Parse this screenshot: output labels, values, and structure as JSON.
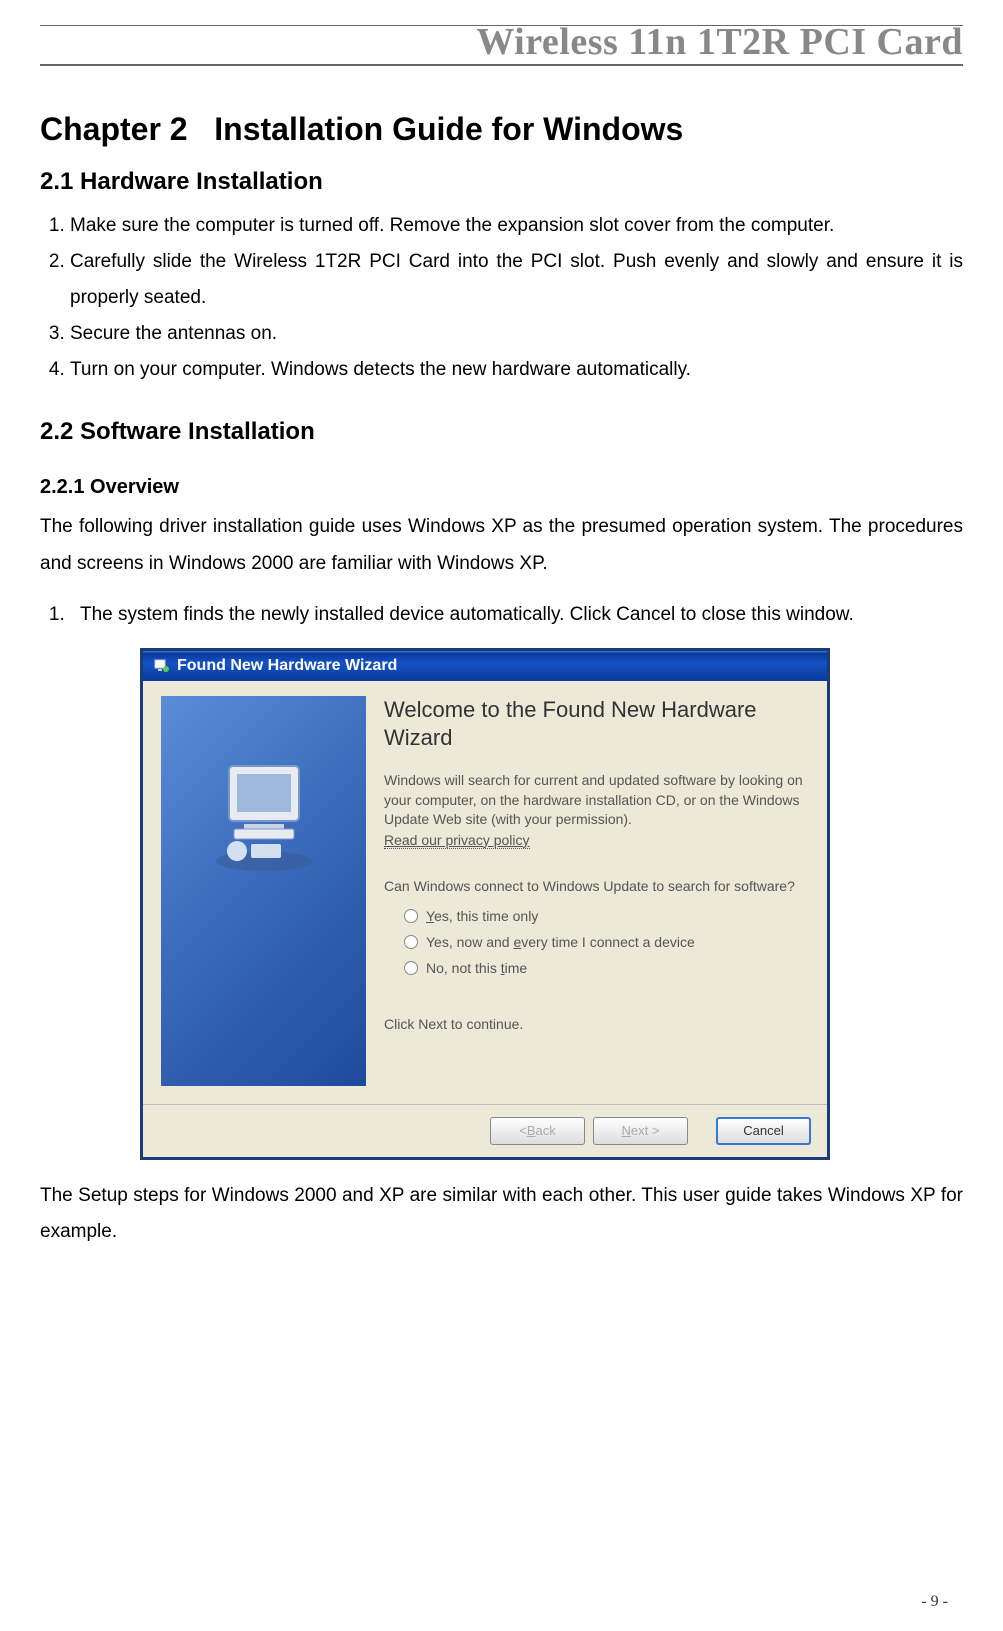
{
  "header": {
    "title": "Wireless 11n 1T2R PCI Card"
  },
  "chapter": {
    "number": "Chapter 2",
    "title": "Installation Guide for Windows"
  },
  "section_hw": {
    "title": "2.1 Hardware Installation",
    "items": [
      "Make sure the computer is turned off. Remove the expansion slot cover from the computer.",
      "Carefully slide the Wireless 1T2R PCI Card into the PCI slot. Push evenly and slowly and ensure it is properly seated.",
      "Secure the antennas on.",
      "Turn on your computer. Windows detects the new hardware automatically."
    ]
  },
  "section_sw": {
    "title": "2.2 Software Installation",
    "overview_title": "2.2.1 Overview",
    "overview_text": "The following driver installation guide uses Windows XP as the presumed operation system. The procedures and screens in Windows 2000 are familiar with Windows XP.",
    "step1_lead": "The system finds the newly installed device automatically. Click ",
    "step1_bold": "Cancel",
    "step1_tail": " to close this window."
  },
  "dialog": {
    "titlebar": "Found New Hardware Wizard",
    "heading": "Welcome to the Found New Hardware Wizard",
    "para": "Windows will search for current and updated software by looking on your computer, on the hardware installation CD, or on the Windows Update Web site (with your permission).",
    "privacy": "Read our privacy policy",
    "question": "Can Windows connect to Windows Update to search for software?",
    "radios": {
      "r1_pre": "",
      "r1_u": "Y",
      "r1_post": "es, this time only",
      "r2_pre": "Yes, now and ",
      "r2_u": "e",
      "r2_post": "very time I connect a device",
      "r3_pre": "No, not this ",
      "r3_u": "t",
      "r3_post": "ime"
    },
    "next_hint": "Click Next to continue.",
    "buttons": {
      "back_pre": "< ",
      "back_u": "B",
      "back_post": "ack",
      "next_u": "N",
      "next_post": "ext >",
      "cancel": "Cancel"
    }
  },
  "note_after_dialog": "The Setup steps for Windows 2000 and XP are similar with each other. This user guide takes Windows XP for example.",
  "page_number": "- 9 -"
}
